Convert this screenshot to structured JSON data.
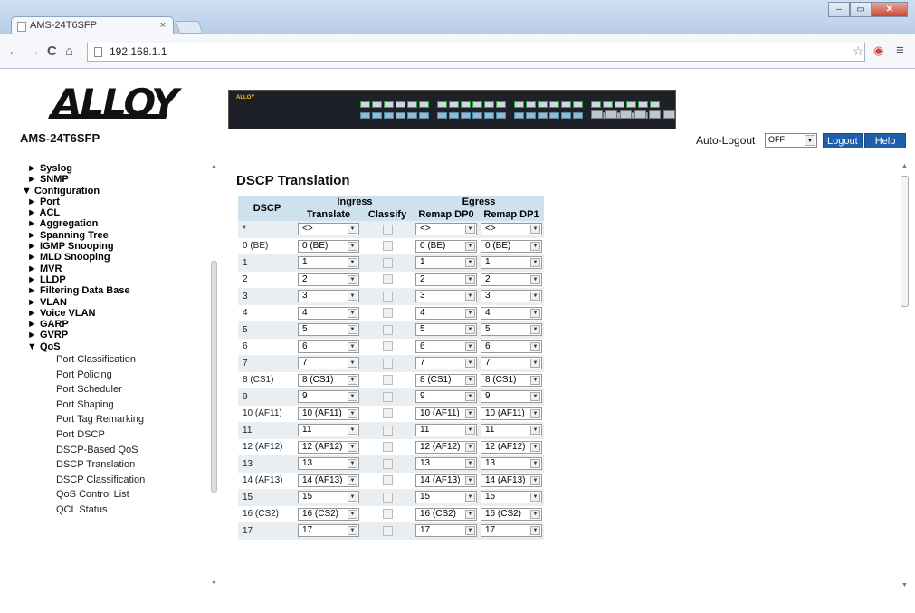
{
  "browser": {
    "tab_title": "AMS-24T6SFP",
    "tab_close": "×",
    "url": "192.168.1.1",
    "window_controls": {
      "minimize": "–",
      "maximize": "▭",
      "close": "✕"
    },
    "nav": {
      "back": "←",
      "forward": "→",
      "reload": "C",
      "home": "⌂"
    },
    "star_icon": "☆",
    "menu_icon": "≡"
  },
  "header": {
    "logo_text": "ALLOY",
    "model": "AMS-24T6SFP",
    "switch_brand": "ALLOY",
    "auto_logout_label": "Auto-Logout",
    "auto_logout_value": "OFF",
    "logout_label": "Logout",
    "help_label": "Help"
  },
  "sidebar": {
    "items": [
      {
        "label": "► Syslog",
        "level": 1
      },
      {
        "label": "► SNMP",
        "level": 1
      },
      {
        "label": "▼ Configuration",
        "level": 0
      },
      {
        "label": "► Port",
        "level": 1
      },
      {
        "label": "► ACL",
        "level": 1
      },
      {
        "label": "► Aggregation",
        "level": 1
      },
      {
        "label": "► Spanning Tree",
        "level": 1
      },
      {
        "label": "► IGMP Snooping",
        "level": 1
      },
      {
        "label": "► MLD Snooping",
        "level": 1
      },
      {
        "label": "► MVR",
        "level": 1
      },
      {
        "label": "► LLDP",
        "level": 1
      },
      {
        "label": "► Filtering Data Base",
        "level": 1
      },
      {
        "label": "► VLAN",
        "level": 1
      },
      {
        "label": "► Voice VLAN",
        "level": 1
      },
      {
        "label": "► GARP",
        "level": 1
      },
      {
        "label": "► GVRP",
        "level": 1
      },
      {
        "label": "▼ QoS",
        "level": 1
      },
      {
        "label": "Port Classification",
        "level": 2
      },
      {
        "label": "Port Policing",
        "level": 2
      },
      {
        "label": "Port Scheduler",
        "level": 2
      },
      {
        "label": "Port Shaping",
        "level": 2
      },
      {
        "label": "Port Tag Remarking",
        "level": 2
      },
      {
        "label": "Port DSCP",
        "level": 2
      },
      {
        "label": "DSCP-Based QoS",
        "level": 2
      },
      {
        "label": "DSCP Translation",
        "level": 2
      },
      {
        "label": "DSCP Classification",
        "level": 2
      },
      {
        "label": "QoS Control List",
        "level": 2
      },
      {
        "label": "QCL Status",
        "level": 2
      }
    ]
  },
  "main": {
    "title": "DSCP Translation",
    "headers": {
      "dscp": "DSCP",
      "ingress": "Ingress",
      "egress": "Egress",
      "translate": "Translate",
      "classify": "Classify",
      "remap0": "Remap DP0",
      "remap1": "Remap DP1"
    },
    "rows": [
      {
        "dscp": "*",
        "translate": "<>",
        "remap0": "<>",
        "remap1": "<>"
      },
      {
        "dscp": "0 (BE)",
        "translate": "0 (BE)",
        "remap0": "0 (BE)",
        "remap1": "0 (BE)"
      },
      {
        "dscp": "1",
        "translate": "1",
        "remap0": "1",
        "remap1": "1"
      },
      {
        "dscp": "2",
        "translate": "2",
        "remap0": "2",
        "remap1": "2"
      },
      {
        "dscp": "3",
        "translate": "3",
        "remap0": "3",
        "remap1": "3"
      },
      {
        "dscp": "4",
        "translate": "4",
        "remap0": "4",
        "remap1": "4"
      },
      {
        "dscp": "5",
        "translate": "5",
        "remap0": "5",
        "remap1": "5"
      },
      {
        "dscp": "6",
        "translate": "6",
        "remap0": "6",
        "remap1": "6"
      },
      {
        "dscp": "7",
        "translate": "7",
        "remap0": "7",
        "remap1": "7"
      },
      {
        "dscp": "8 (CS1)",
        "translate": "8 (CS1)",
        "remap0": "8 (CS1)",
        "remap1": "8 (CS1)"
      },
      {
        "dscp": "9",
        "translate": "9",
        "remap0": "9",
        "remap1": "9"
      },
      {
        "dscp": "10 (AF11)",
        "translate": "10 (AF11)",
        "remap0": "10 (AF11)",
        "remap1": "10 (AF11)"
      },
      {
        "dscp": "11",
        "translate": "11",
        "remap0": "11",
        "remap1": "11"
      },
      {
        "dscp": "12 (AF12)",
        "translate": "12 (AF12)",
        "remap0": "12 (AF12)",
        "remap1": "12 (AF12)"
      },
      {
        "dscp": "13",
        "translate": "13",
        "remap0": "13",
        "remap1": "13"
      },
      {
        "dscp": "14 (AF13)",
        "translate": "14 (AF13)",
        "remap0": "14 (AF13)",
        "remap1": "14 (AF13)"
      },
      {
        "dscp": "15",
        "translate": "15",
        "remap0": "15",
        "remap1": "15"
      },
      {
        "dscp": "16 (CS2)",
        "translate": "16 (CS2)",
        "remap0": "16 (CS2)",
        "remap1": "16 (CS2)"
      },
      {
        "dscp": "17",
        "translate": "17",
        "remap0": "17",
        "remap1": "17"
      }
    ]
  }
}
